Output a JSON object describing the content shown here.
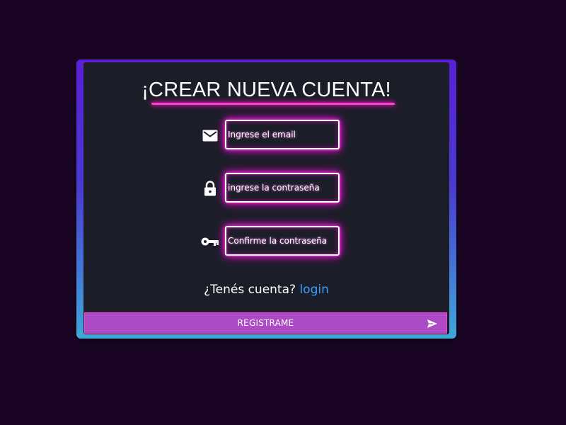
{
  "form": {
    "title": "¡CREAR NUEVA CUENTA!",
    "fields": [
      {
        "icon": "email-icon",
        "placeholder": "Ingrese el email"
      },
      {
        "icon": "lock-icon",
        "placeholder": "ingrese la contraseña"
      },
      {
        "icon": "key-icon",
        "placeholder": "Confirme la contraseña"
      }
    ],
    "have_account_text": "¿Tenés cuenta?",
    "login_link": "login",
    "submit_label": "REGISTRAME",
    "submit_icon": "send-icon"
  },
  "colors": {
    "page_background": "#1a0525",
    "card_background": "#1b1e28",
    "neon_accent": "#ff3fd2",
    "button_background": "#ad4ac6",
    "link": "#3aa0ff"
  }
}
